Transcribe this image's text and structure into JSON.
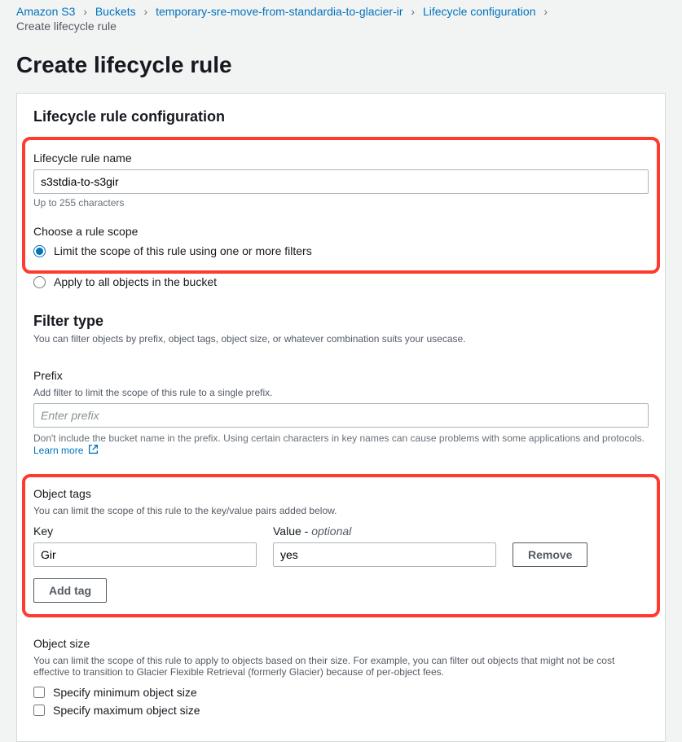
{
  "breadcrumb": {
    "items": [
      "Amazon S3",
      "Buckets",
      "temporary-sre-move-from-standardia-to-glacier-ir",
      "Lifecycle configuration"
    ],
    "current": "Create lifecycle rule"
  },
  "page_title": "Create lifecycle rule",
  "config": {
    "section_title": "Lifecycle rule configuration",
    "name_label": "Lifecycle rule name",
    "name_value": "s3stdia-to-s3gir",
    "name_help": "Up to 255 characters",
    "scope_label": "Choose a rule scope",
    "scope_options": {
      "limit": "Limit the scope of this rule using one or more filters",
      "all": "Apply to all objects in the bucket"
    }
  },
  "filter": {
    "title": "Filter type",
    "desc": "You can filter objects by prefix, object tags, object size, or whatever combination suits your usecase.",
    "prefix_label": "Prefix",
    "prefix_desc": "Add filter to limit the scope of this rule to a single prefix.",
    "prefix_placeholder": "Enter prefix",
    "prefix_help": "Don't include the bucket name in the prefix. Using certain characters in key names can cause problems with some applications and protocols. ",
    "learn_more": "Learn more"
  },
  "tags": {
    "title": "Object tags",
    "desc": "You can limit the scope of this rule to the key/value pairs added below.",
    "key_label": "Key",
    "value_label": "Value - ",
    "value_optional": "optional",
    "key_value": "Gir",
    "value_value": "yes",
    "remove_label": "Remove",
    "add_label": "Add tag"
  },
  "size": {
    "title": "Object size",
    "desc": "You can limit the scope of this rule to apply to objects based on their size. For example, you can filter out objects that might not be cost effective to transition to Glacier Flexible Retrieval (formerly Glacier) because of per-object fees.",
    "min_label": "Specify minimum object size",
    "max_label": "Specify maximum object size"
  }
}
